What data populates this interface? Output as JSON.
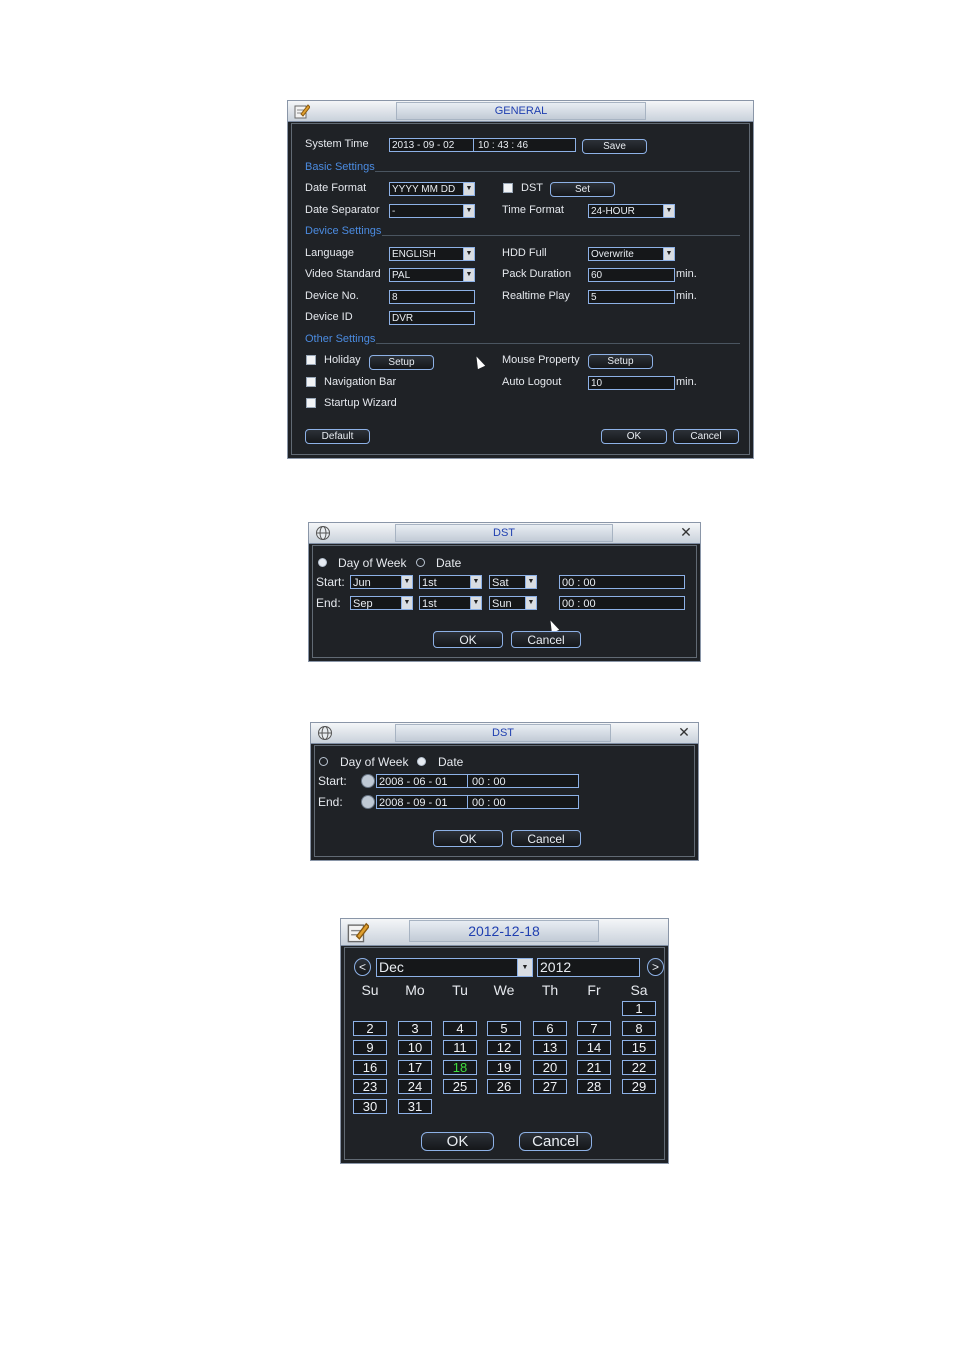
{
  "general": {
    "title": "GENERAL",
    "system_time_label": "System Time",
    "system_date": "2013 - 09 - 02",
    "system_clock": "10 : 43 : 46",
    "save_label": "Save",
    "basic_settings": "Basic Settings",
    "date_format_label": "Date Format",
    "date_format_value": "YYYY MM DD",
    "dst_label": "DST",
    "set_label": "Set",
    "date_separator_label": "Date Separator",
    "date_separator_value": "-",
    "time_format_label": "Time Format",
    "time_format_value": "24-HOUR",
    "device_settings": "Device Settings",
    "language_label": "Language",
    "language_value": "ENGLISH",
    "hdd_full_label": "HDD Full",
    "hdd_full_value": "Overwrite",
    "video_standard_label": "Video Standard",
    "video_standard_value": "PAL",
    "pack_duration_label": "Pack Duration",
    "pack_duration_value": "60",
    "device_no_label": "Device No.",
    "device_no_value": "8",
    "realtime_play_label": "Realtime Play",
    "realtime_play_value": "5",
    "device_id_label": "Device ID",
    "device_id_value": "DVR",
    "min_unit": "min.",
    "other_settings": "Other Settings",
    "holiday_label": "Holiday",
    "setup_label": "Setup",
    "mouse_property_label": "Mouse Property",
    "navigation_bar_label": "Navigation Bar",
    "auto_logout_label": "Auto Logout",
    "auto_logout_value": "10",
    "startup_wizard_label": "Startup Wizard",
    "default_label": "Default",
    "ok_label": "OK",
    "cancel_label": "Cancel"
  },
  "dst1": {
    "title": "DST",
    "day_of_week_label": "Day of Week",
    "date_label": "Date",
    "start_label": "Start:",
    "end_label": "End:",
    "start_month": "Jun",
    "start_week": "1st",
    "start_day": "Sat",
    "start_time": "00  :  00",
    "end_month": "Sep",
    "end_week": "1st",
    "end_day": "Sun",
    "end_time": "00  :  00",
    "ok_label": "OK",
    "cancel_label": "Cancel"
  },
  "dst2": {
    "title": "DST",
    "day_of_week_label": "Day of Week",
    "date_label": "Date",
    "start_label": "Start:",
    "end_label": "End:",
    "start_date": "2008  - 06 - 01",
    "start_time": "00 : 00",
    "end_date": "2008  - 09 - 01",
    "end_time": "00 : 00",
    "ok_label": "OK",
    "cancel_label": "Cancel"
  },
  "calendar": {
    "title": "2012-12-18",
    "prev_label": "<",
    "next_label": ">",
    "month": "Dec",
    "year": "2012",
    "weekdays": [
      "Su",
      "Mo",
      "Tu",
      "We",
      "Th",
      "Fr",
      "Sa"
    ],
    "days": [
      "1",
      "2",
      "3",
      "4",
      "5",
      "6",
      "7",
      "8",
      "9",
      "10",
      "11",
      "12",
      "13",
      "14",
      "15",
      "16",
      "17",
      "18",
      "19",
      "20",
      "21",
      "22",
      "23",
      "24",
      "25",
      "26",
      "27",
      "28",
      "29",
      "30",
      "31"
    ],
    "first_weekday": 6,
    "selected_day": "18",
    "selected_color": "#3fdc3f",
    "ok_label": "OK",
    "cancel_label": "Cancel"
  }
}
